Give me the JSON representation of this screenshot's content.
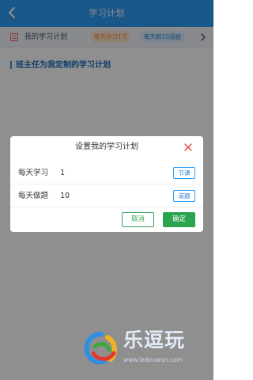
{
  "header": {
    "title": "学习计划",
    "back_icon": "back-arrow-icon"
  },
  "plan_bar": {
    "label": "我的学习计划",
    "chip_lessons": "每天学习1节",
    "chip_questions": "每天刷10道题",
    "icon": "list-icon",
    "chevron": "chevron-right-icon"
  },
  "section": {
    "title": "班主任为我定制的学习计划"
  },
  "dialog": {
    "title": "设置我的学习计划",
    "close_icon": "close-icon",
    "rows": [
      {
        "label": "每天学习",
        "value": "1",
        "unit": "节课"
      },
      {
        "label": "每天做题",
        "value": "10",
        "unit": "道题"
      }
    ],
    "cancel_label": "取消",
    "confirm_label": "确定"
  },
  "watermark": {
    "name": "乐逗玩",
    "url": "www.ledouwan.com"
  },
  "colors": {
    "header_blue": "#2f9cf4",
    "confirm_green": "#2aa44f",
    "close_red": "#e8453c",
    "chip_orange": "#ff8a2a"
  }
}
